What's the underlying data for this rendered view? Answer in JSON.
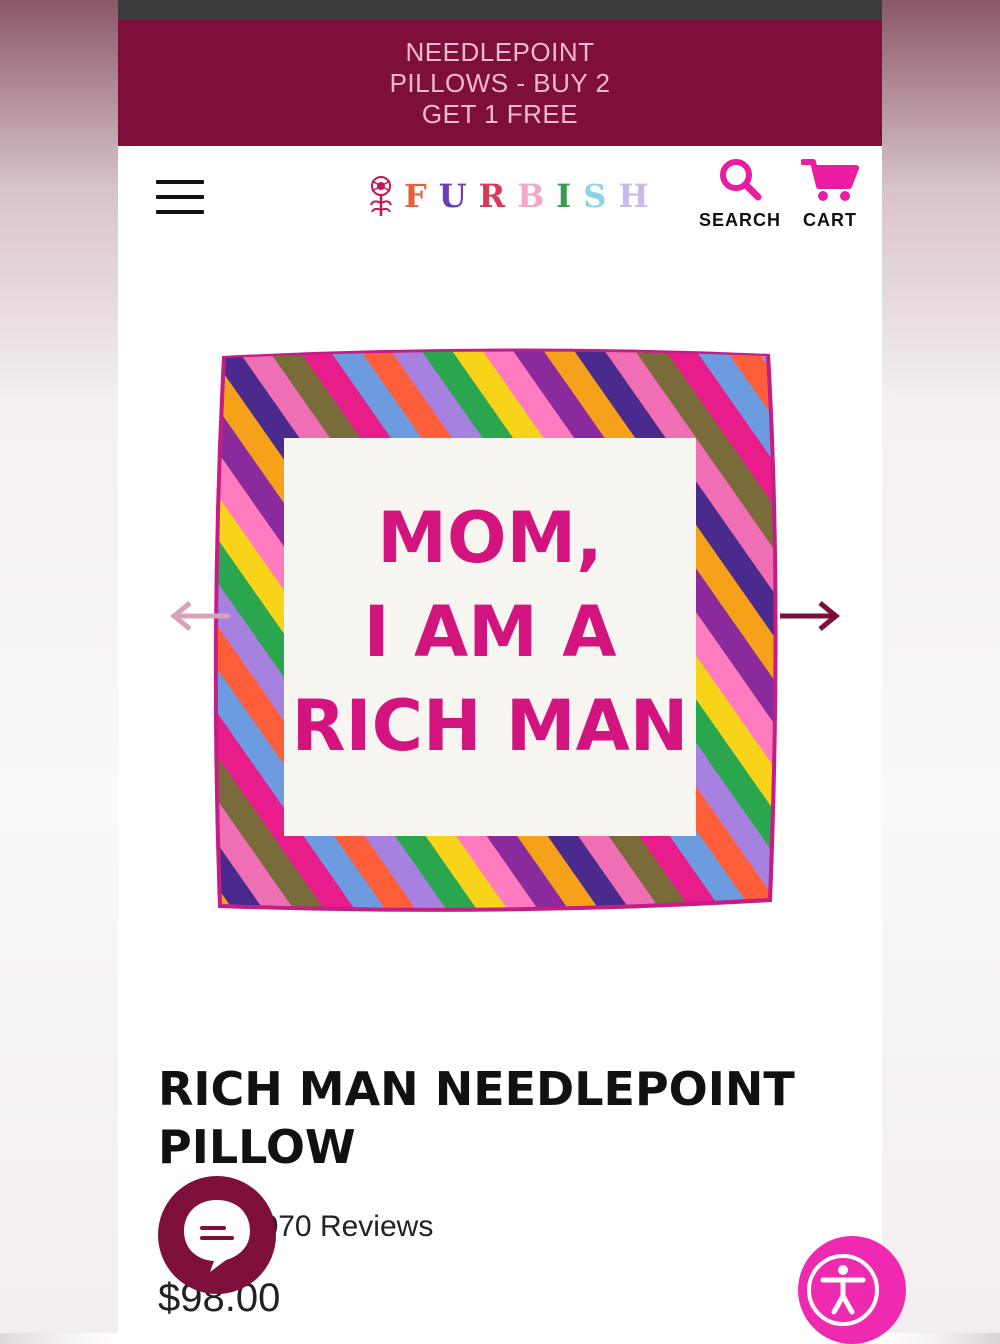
{
  "promo": {
    "text": "NEEDLEPOINT PILLOWS - BUY 2 GET 1 FREE"
  },
  "header": {
    "menu_icon": "hamburger-icon",
    "logo": {
      "letters": [
        "F",
        "U",
        "R",
        "B",
        "I",
        "S",
        "H"
      ],
      "colors": [
        "#e8603b",
        "#6a3fb8",
        "#d63a58",
        "#f2a7c9",
        "#3a9a4d",
        "#8dd3e8",
        "#c9b8e8"
      ]
    },
    "search_label": "SEARCH",
    "cart_label": "CART",
    "search_icon": "search-icon",
    "cart_icon": "cart-icon"
  },
  "product": {
    "image_text": [
      "MOM,",
      "I AM A",
      "RICH MAN"
    ],
    "title": "RICH MAN NEEDLEPOINT PILLOW",
    "stars": "★★",
    "reviews": "1,070 Reviews",
    "price": "$98.00"
  },
  "colors": {
    "brand": "#7e0f3b",
    "accent": "#e91ca2",
    "promo_text": "#f1b8d1"
  }
}
